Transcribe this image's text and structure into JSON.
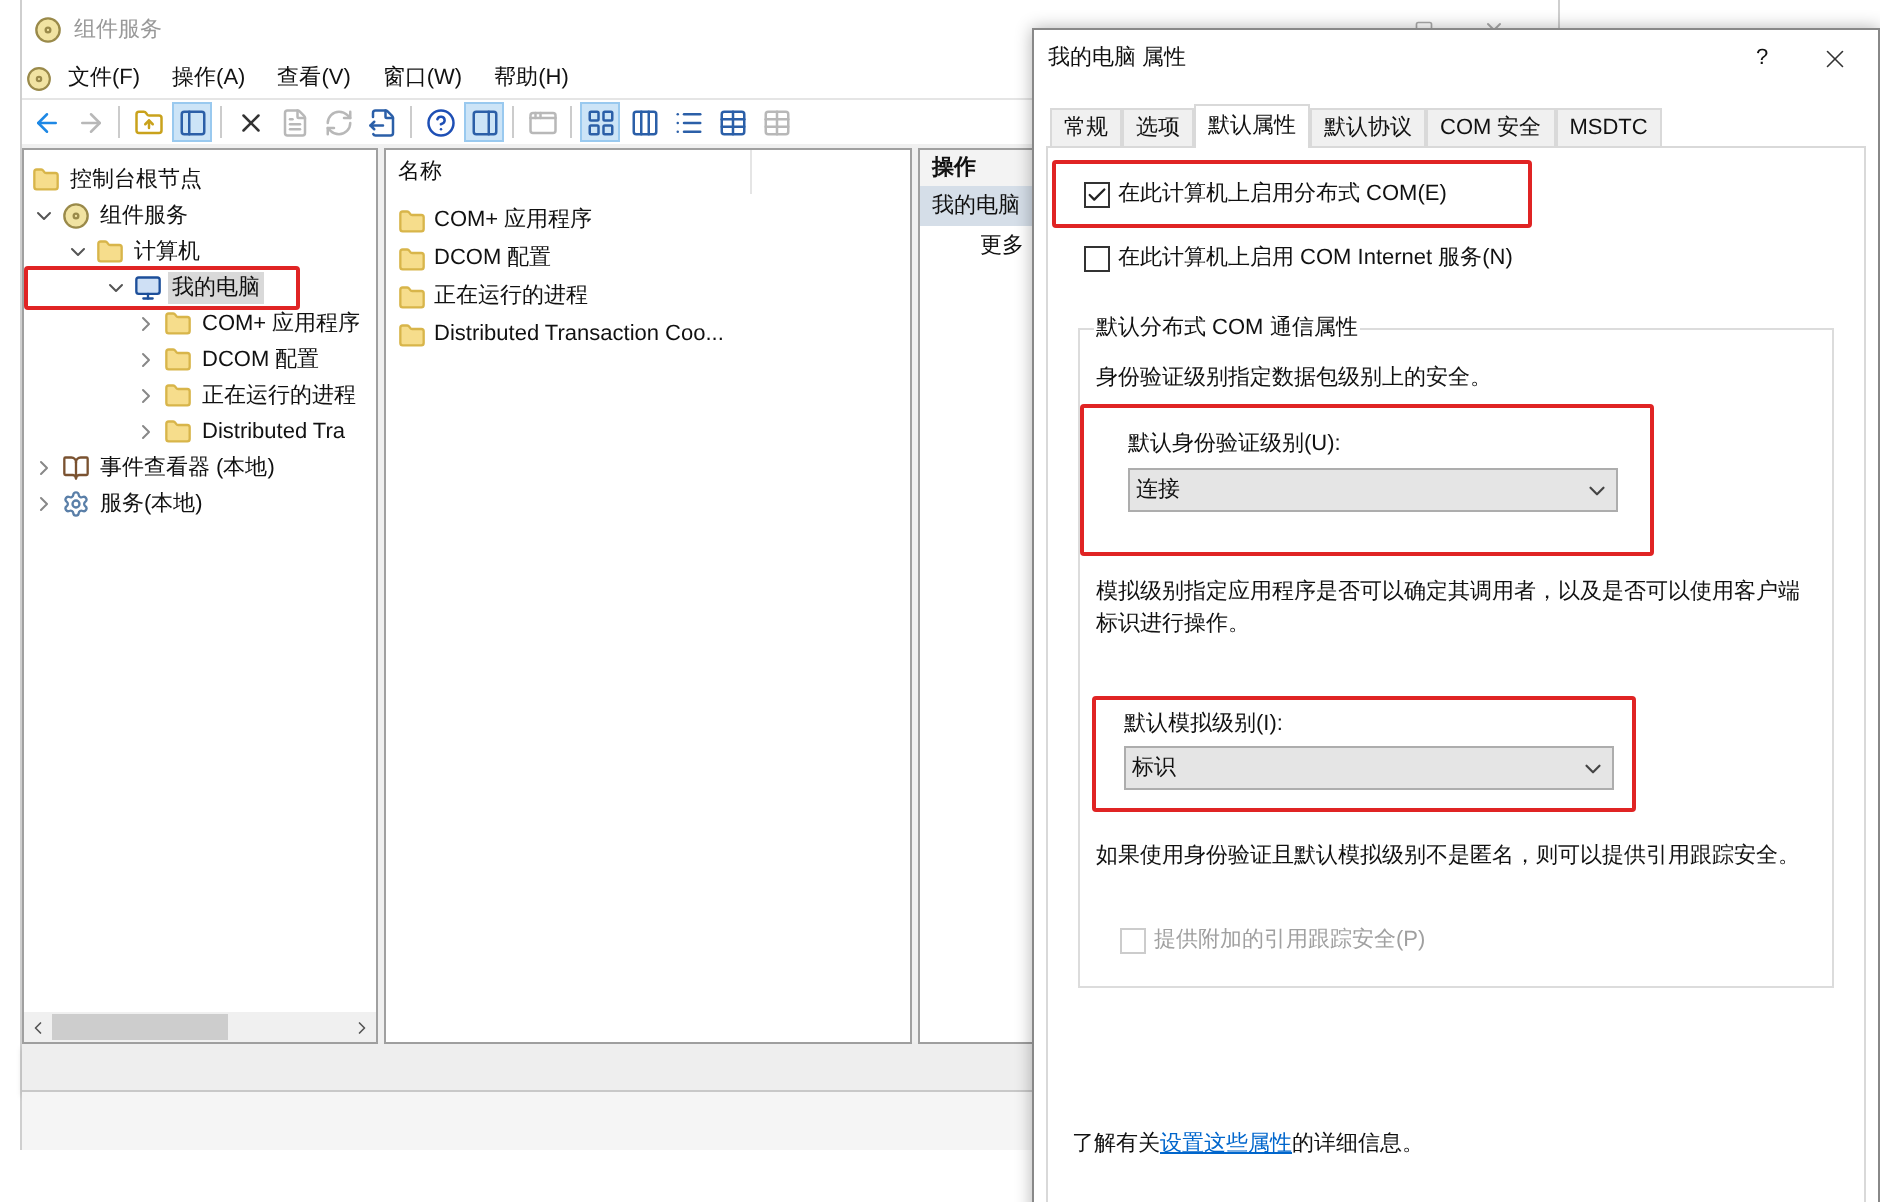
{
  "main_window": {
    "title": "组件服务",
    "menu": [
      "文件(F)",
      "操作(A)",
      "查看(V)",
      "窗口(W)",
      "帮助(H)"
    ],
    "toolbar": [
      {
        "kind": "back",
        "pressed": false,
        "disabled": false
      },
      {
        "kind": "forward",
        "pressed": false,
        "disabled": true
      },
      {
        "kind": "separator"
      },
      {
        "kind": "up",
        "pressed": false,
        "disabled": false
      },
      {
        "kind": "tree-pane",
        "pressed": true,
        "disabled": false
      },
      {
        "kind": "separator"
      },
      {
        "kind": "delete",
        "pressed": false,
        "disabled": false
      },
      {
        "kind": "properties",
        "pressed": false,
        "disabled": true
      },
      {
        "kind": "refresh",
        "pressed": false,
        "disabled": true
      },
      {
        "kind": "export",
        "pressed": false,
        "disabled": false
      },
      {
        "kind": "separator"
      },
      {
        "kind": "help",
        "pressed": false,
        "disabled": false
      },
      {
        "kind": "action-pane",
        "pressed": true,
        "disabled": false
      },
      {
        "kind": "separator"
      },
      {
        "kind": "new-window",
        "pressed": false,
        "disabled": true
      },
      {
        "kind": "separator"
      },
      {
        "kind": "large-icons",
        "pressed": true,
        "disabled": false
      },
      {
        "kind": "small-icons",
        "pressed": false,
        "disabled": false
      },
      {
        "kind": "list",
        "pressed": false,
        "disabled": false
      },
      {
        "kind": "details",
        "pressed": false,
        "disabled": false
      },
      {
        "kind": "configure",
        "pressed": false,
        "disabled": true
      }
    ],
    "tree": [
      {
        "label": "控制台根节点",
        "kind": "folder",
        "selected": false,
        "highlighted": false,
        "children": [
          {
            "label": "组件服务",
            "kind": "component",
            "expanded": true,
            "selected": false,
            "highlighted": false,
            "children": [
              {
                "label": "计算机",
                "kind": "folder",
                "expanded": true,
                "selected": false,
                "highlighted": false,
                "children": [
                  {
                    "label": "我的电脑",
                    "kind": "computer",
                    "expanded": true,
                    "selected": true,
                    "highlighted": true,
                    "children": [
                      {
                        "label": "COM+ 应用程序",
                        "kind": "folder",
                        "expanded": false,
                        "selected": false,
                        "highlighted": false
                      },
                      {
                        "label": "DCOM 配置",
                        "kind": "folder",
                        "expanded": false,
                        "selected": false,
                        "highlighted": false
                      },
                      {
                        "label": "正在运行的进程",
                        "kind": "folder",
                        "expanded": false,
                        "selected": false,
                        "highlighted": false
                      },
                      {
                        "label": "Distributed Tra",
                        "kind": "folder",
                        "expanded": false,
                        "selected": false,
                        "highlighted": false
                      }
                    ]
                  }
                ]
              }
            ]
          },
          {
            "label": "事件查看器 (本地)",
            "kind": "log",
            "expanded": false,
            "selected": false,
            "highlighted": false
          },
          {
            "label": "服务(本地)",
            "kind": "service",
            "expanded": false,
            "selected": false,
            "highlighted": false
          }
        ]
      }
    ],
    "list": {
      "column": "名称",
      "items": [
        "COM+ 应用程序",
        "DCOM 配置",
        "正在运行的进程",
        "Distributed Transaction Coo..."
      ]
    },
    "actions": {
      "header": "操作",
      "items": [
        {
          "label": "我的电脑",
          "kind": "heading",
          "selected": true
        },
        {
          "label": "更多",
          "kind": "action",
          "selected": false
        }
      ]
    }
  },
  "dialog": {
    "title": "我的电脑 属性",
    "help": "?",
    "tabs": [
      {
        "label": "常规",
        "selected": false
      },
      {
        "label": "选项",
        "selected": false
      },
      {
        "label": "默认属性",
        "selected": true
      },
      {
        "label": "默认协议",
        "selected": false
      },
      {
        "label": "COM 安全",
        "selected": false
      },
      {
        "label": "MSDTC",
        "selected": false
      }
    ],
    "checkboxes": [
      {
        "label": "在此计算机上启用分布式 COM(E)",
        "checked": true,
        "highlighted": true
      },
      {
        "label": "在此计算机上启用 COM Internet 服务(N)",
        "checked": false,
        "highlighted": false
      }
    ],
    "group": {
      "title": "默认分布式 COM 通信属性",
      "auth_note": "身份验证级别指定数据包级别上的安全。",
      "auth": {
        "label": "默认身份验证级别(U):",
        "value": "连接",
        "highlighted": true
      },
      "impersonation_note": "模拟级别指定应用程序是否可以确定其调用者，以及是否可以使用客户端标识进行操作。",
      "impersonation": {
        "label": "默认模拟级别(I):",
        "value": "标识",
        "highlighted": true
      },
      "tracking_note": "如果使用身份验证且默认模拟级别不是匿名，则可以提供引用跟踪安全。",
      "tracking": {
        "label": "提供附加的引用跟踪安全(P)",
        "checked": false,
        "disabled": true
      }
    },
    "footer": {
      "before": "了解有关",
      "link": "设置这些属性",
      "after": "的详细信息。"
    }
  }
}
